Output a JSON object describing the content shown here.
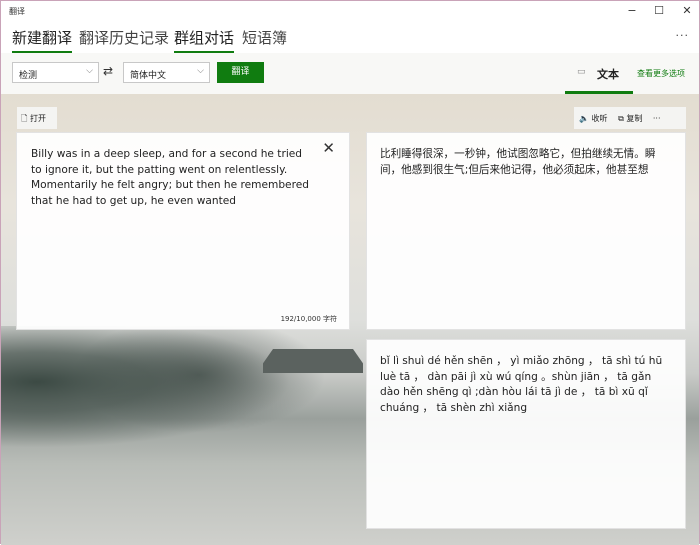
{
  "window": {
    "title": "翻译",
    "minimize": "−",
    "maximize": "☐",
    "close": "✕"
  },
  "tabs": [
    {
      "label": "新建翻译",
      "active": true
    },
    {
      "label": "翻译历史记录",
      "active": false
    },
    {
      "label": "群组对话",
      "active": true
    },
    {
      "label": "短语簿",
      "active": false
    }
  ],
  "more_menu": "···",
  "toolbar": {
    "source_lang": "检测",
    "target_lang": "简体中文",
    "swap_icon": "⇄",
    "translate_label": "翻译",
    "mode_label": "文本",
    "more_options": "查看更多选项"
  },
  "input": {
    "open_label": "打开",
    "text": "Billy was in a deep sleep, and for a second he tried to ignore it, but the patting went on relentlessly. Momentarily he felt angry; but then he remembered that he had to get up, he even wanted",
    "char_count": "192/10,000 字符"
  },
  "output": {
    "listen_label": "收听",
    "copy_label": "复制",
    "more": "···",
    "translation": "比利睡得很深，一秒钟，他试图忽略它，但拍继续无情。瞬间，他感到很生气;但后来他记得，他必须起床，他甚至想",
    "pinyin": "bǐ lì shuì dé hěn shēn ， yì miǎo zhōng ， tā shì tú hū luè tā ， dàn pāi jì xù wú qíng 。shùn jiān ， tā gǎn dào hěn shēng qì ;dàn hòu lái tā jì de ， tā bì xū qǐ chuáng ， tā shèn zhì xiǎng"
  },
  "colors": {
    "accent": "#107c10"
  }
}
